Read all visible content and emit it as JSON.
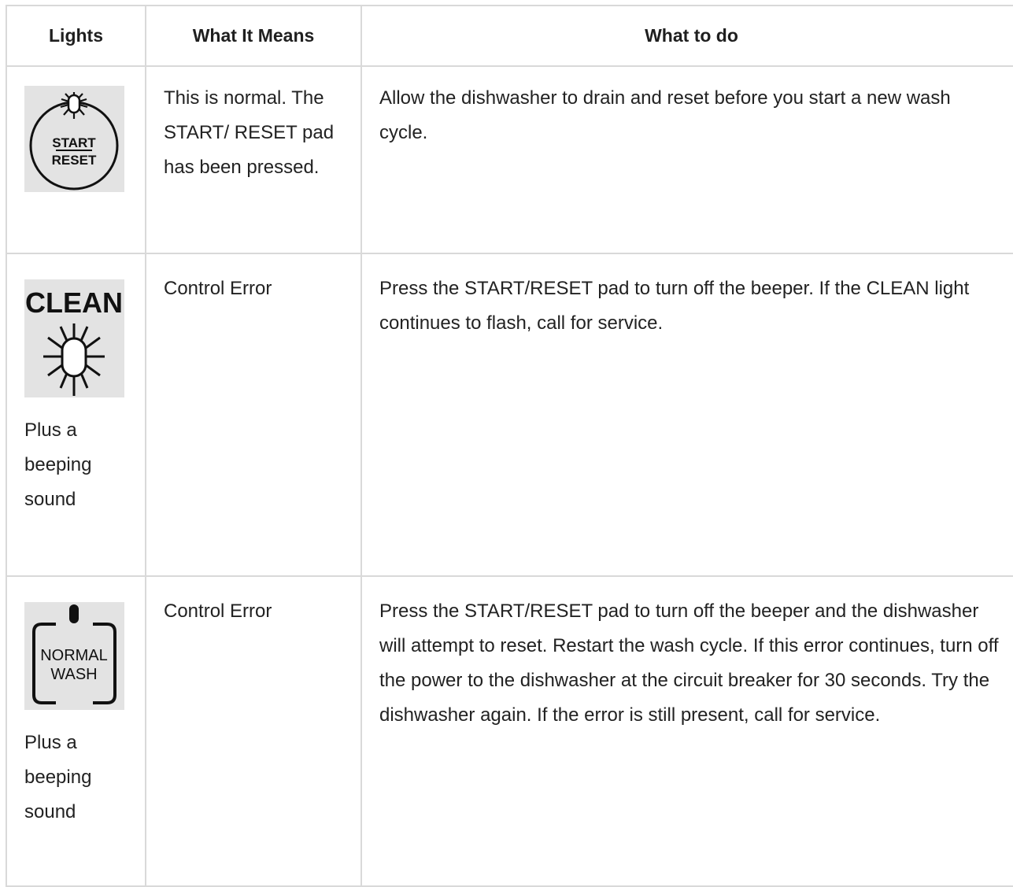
{
  "table": {
    "headers": [
      "Lights",
      "What It Means",
      "What to do"
    ],
    "rows": [
      {
        "icon": "start-reset-light-icon",
        "icon_text": [
          "START",
          "RESET"
        ],
        "note": "",
        "meaning": "This is normal. The START/ RESET pad has been pressed.",
        "action": "Allow the dishwasher to drain and reset before you start a new wash cycle."
      },
      {
        "icon": "clean-flashing-light-icon",
        "icon_text": [
          "CLEAN"
        ],
        "note": "Plus a beeping sound",
        "meaning": "Control Error",
        "action": "Press the START/RESET pad to turn off the beeper. If the CLEAN light continues to flash, call for service."
      },
      {
        "icon": "normal-wash-light-icon",
        "icon_text": [
          "NORMAL",
          "WASH"
        ],
        "note": "Plus a beeping sound",
        "meaning": "Control Error",
        "action": "Press the START/RESET pad to turn off the beeper and the dishwasher will attempt to reset. Restart the wash cycle. If this error continues, turn off the power to the dishwasher at the circuit breaker for 30 seconds. Try the dishwasher again. If the error is still present, call for service."
      }
    ]
  }
}
